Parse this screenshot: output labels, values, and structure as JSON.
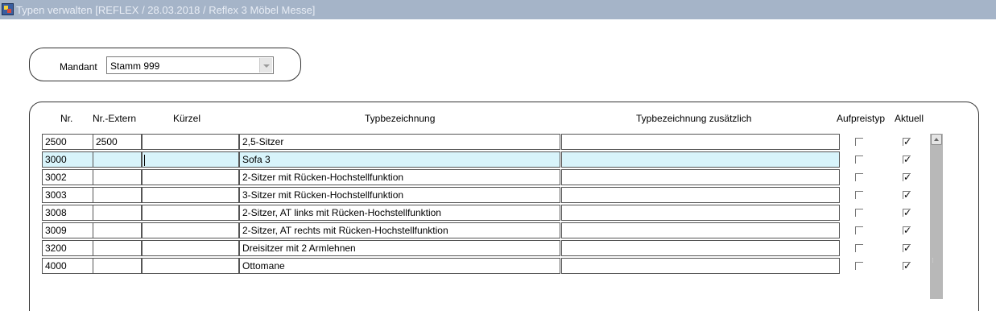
{
  "window": {
    "title": "Typen verwalten   [REFLEX / 28.03.2018 / Reflex 3 Möbel Messe]",
    "icon": "app-icon"
  },
  "mandant": {
    "label": "Mandant",
    "value": "Stamm 999"
  },
  "table": {
    "headers": {
      "nr": "Nr.",
      "nr_extern": "Nr.-Extern",
      "kuerzel": "Kürzel",
      "typbezeichnung": "Typbezeichnung",
      "typbezeichnung_zusaetzlich": "Typbezeichnung zusätzlich",
      "aufpreistyp": "Aufpreistyp",
      "aktuell": "Aktuell"
    },
    "rows": [
      {
        "nr": "2500",
        "nr_extern": "2500",
        "kuerzel": "",
        "typbezeichnung": "2,5-Sitzer",
        "zusaetzlich": "",
        "aufpreistyp": false,
        "aktuell": true
      },
      {
        "nr": "3000",
        "nr_extern": "",
        "kuerzel": "",
        "typbezeichnung": "Sofa 3",
        "zusaetzlich": "",
        "aufpreistyp": false,
        "aktuell": true
      },
      {
        "nr": "3002",
        "nr_extern": "",
        "kuerzel": "",
        "typbezeichnung": "2-Sitzer  mit Rücken-Hochstellfunktion",
        "zusaetzlich": "",
        "aufpreistyp": false,
        "aktuell": true
      },
      {
        "nr": "3003",
        "nr_extern": "",
        "kuerzel": "",
        "typbezeichnung": "3-Sitzer  mit Rücken-Hochstellfunktion",
        "zusaetzlich": "",
        "aufpreistyp": false,
        "aktuell": true
      },
      {
        "nr": "3008",
        "nr_extern": "",
        "kuerzel": "",
        "typbezeichnung": "2-Sitzer, AT links mit Rücken-Hochstellfunktion",
        "zusaetzlich": "",
        "aufpreistyp": false,
        "aktuell": true
      },
      {
        "nr": "3009",
        "nr_extern": "",
        "kuerzel": "",
        "typbezeichnung": "2-Sitzer, AT rechts mit Rücken-Hochstellfunktion",
        "zusaetzlich": "",
        "aufpreistyp": false,
        "aktuell": true
      },
      {
        "nr": "3200",
        "nr_extern": "",
        "kuerzel": "",
        "typbezeichnung": "Dreisitzer mit 2 Armlehnen",
        "zusaetzlich": "",
        "aufpreistyp": false,
        "aktuell": true
      },
      {
        "nr": "4000",
        "nr_extern": "",
        "kuerzel": "",
        "typbezeichnung": "Ottomane",
        "zusaetzlich": "",
        "aufpreistyp": false,
        "aktuell": true
      }
    ],
    "active_row": 1
  },
  "colors": {
    "titlebar": "#a5b4c8",
    "active_row": "#d8f4fb"
  }
}
